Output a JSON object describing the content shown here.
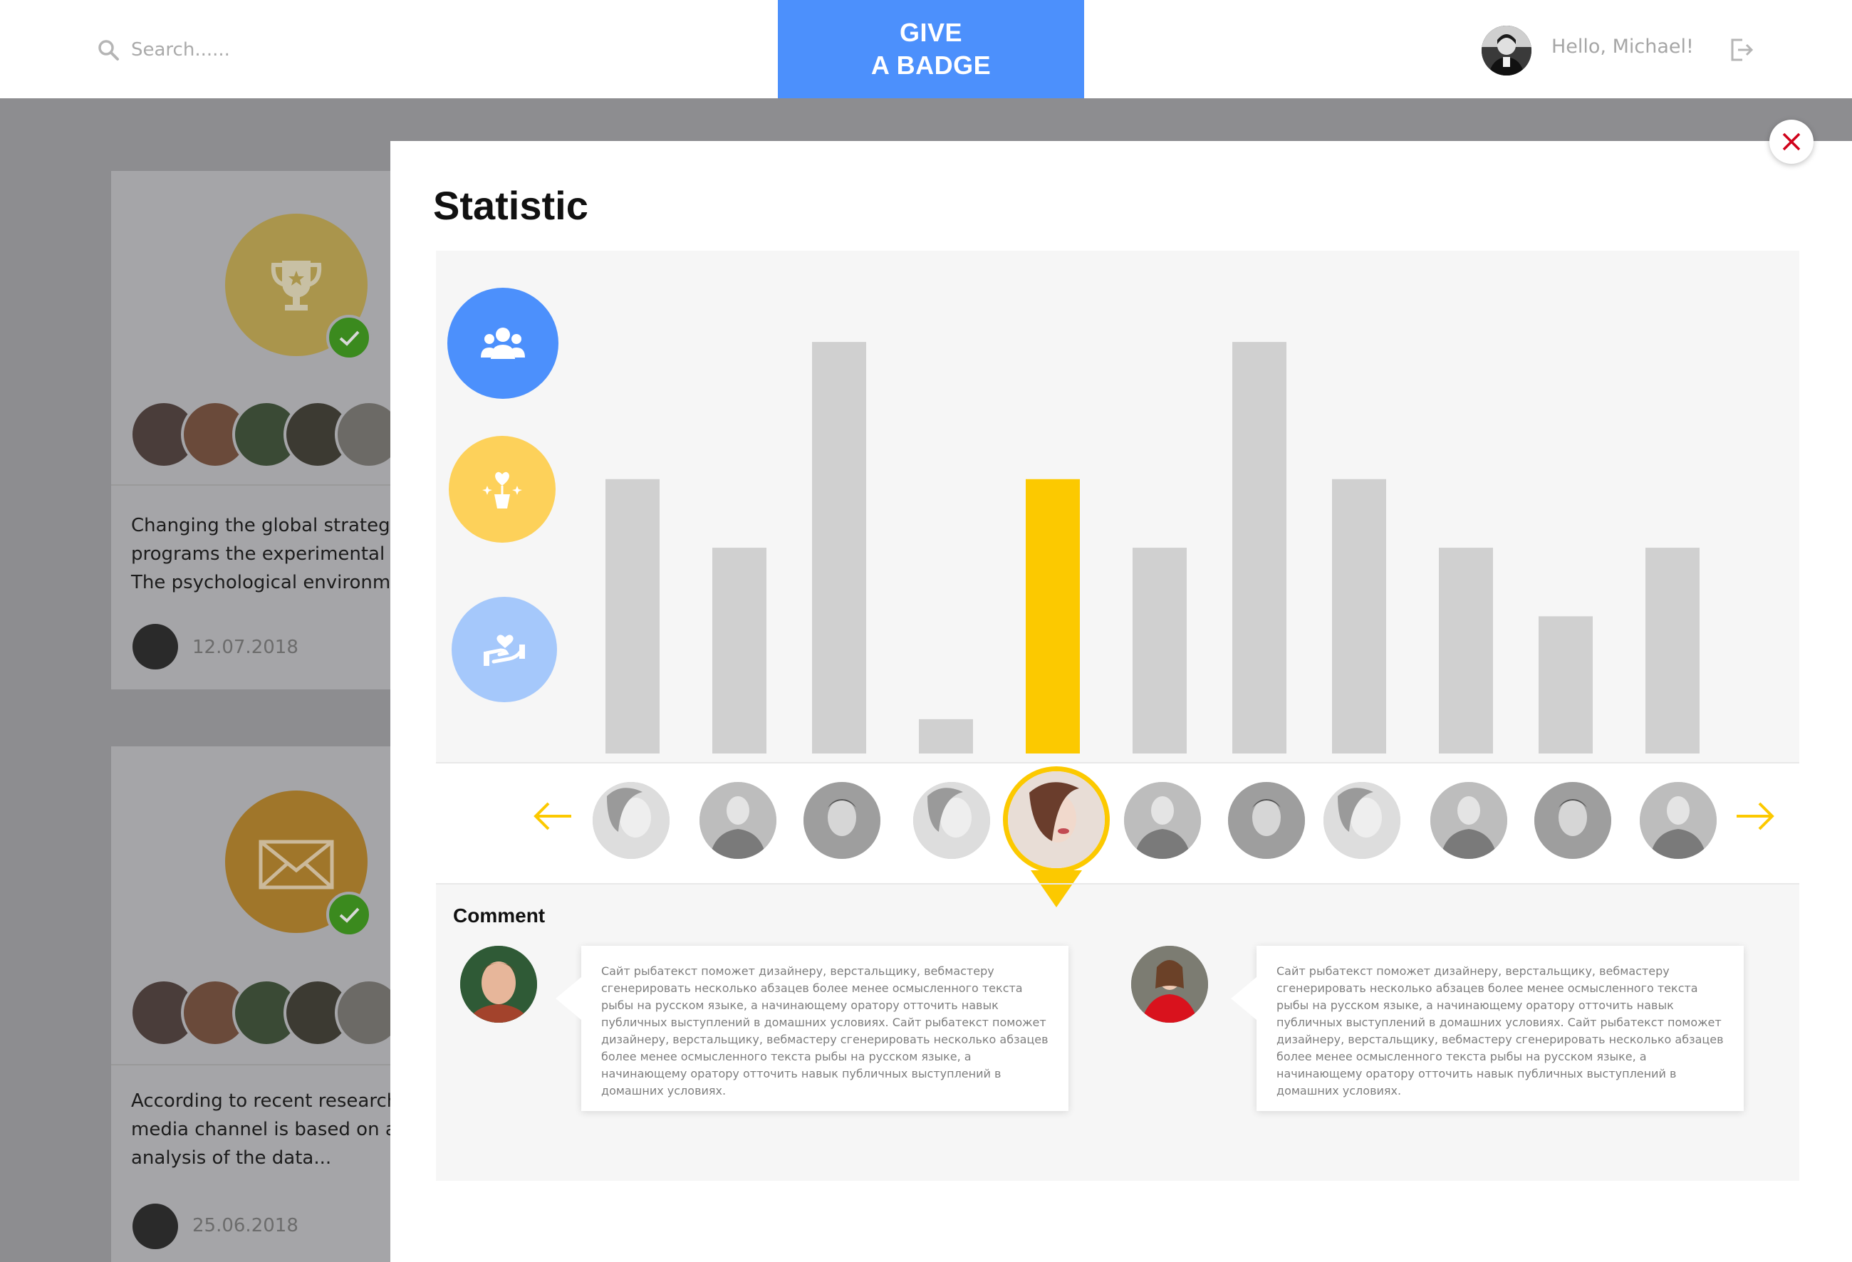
{
  "header": {
    "search_placeholder": "Search......",
    "give_badge_line1": "GIVE",
    "give_badge_line2": "A BADGE",
    "greeting": "Hello, Michael!"
  },
  "feed": {
    "cards": [
      {
        "badge_icon": "trophy-icon",
        "text": "Changing the global strategy\nprograms the experimental cre\nThe psychological environmen",
        "date": "12.07.2018"
      },
      {
        "badge_icon": "envelope-icon",
        "text": "According to recent research, t\nmedia channel is based on a th\nanalysis of the data...",
        "date": "25.06.2018"
      }
    ]
  },
  "modal": {
    "title": "Statistic",
    "comment_label": "Comment",
    "categories": [
      {
        "icon": "team-icon",
        "color": "#4c90fc"
      },
      {
        "icon": "heart-plant-icon",
        "color": "#fdd15a"
      },
      {
        "icon": "helping-hands-icon",
        "color": "#a5c8fb"
      }
    ],
    "comments": [
      {
        "text": "Сайт рыбатекст поможет дизайнеру, верстальщику, вебмастеру сгенерировать несколько абзацев более менее осмысленного текста рыбы на русском языке, а начинающему оратору отточить навык публичных выступлений в домашних условиях.  Сайт рыбатекст поможет дизайнеру, верстальщику, вебмастеру сгенерировать несколько абзацев более менее осмысленного текста рыбы на русском языке, а начинающему оратору отточить навык публичных выступлений в домашних условиях."
      },
      {
        "text": "Сайт рыбатекст поможет дизайнеру, верстальщику, вебмастеру сгенерировать несколько абзацев более менее осмысленного текста рыбы на русском языке, а начинающему оратору отточить навык публичных выступлений в домашних условиях.  Сайт рыбатекст поможет дизайнеру, верстальщику, вебмастеру сгенерировать несколько абзацев более менее осмысленного текста рыбы на русском языке, а начинающему оратору отточить навык публичных выступлений в домашних условиях."
      }
    ]
  },
  "chart_data": {
    "type": "bar",
    "values": [
      4,
      3,
      6,
      0.5,
      4,
      3,
      6,
      4,
      3,
      2,
      3
    ],
    "highlighted_index": 4,
    "ylim": [
      0,
      6.5
    ],
    "colors": {
      "default": "#d0d0d0",
      "highlight": "#fcc900"
    }
  },
  "colors": {
    "accent_blue": "#4c90fc",
    "accent_yellow": "#fcc900",
    "close_red": "#d0021b"
  }
}
